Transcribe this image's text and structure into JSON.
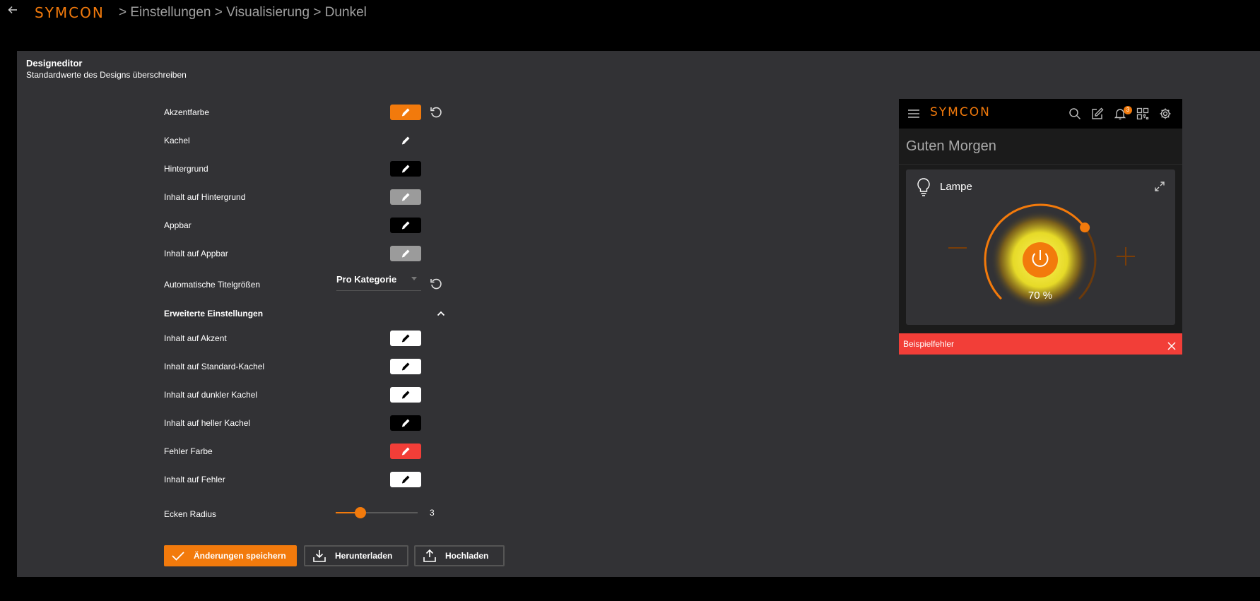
{
  "topbar": {
    "logo": "SYMCON",
    "breadcrumb": "> Einstellungen > Visualisierung > Dunkel"
  },
  "editor": {
    "title": "Designeditor",
    "subtitle": "Standardwerte des Designs überschreiben",
    "rows": [
      {
        "label": "Akzentfarbe",
        "color": "#f27a0c",
        "pen": "#ffffff"
      },
      {
        "label": "Kachel",
        "color": "#323235",
        "pen": "#ffffff"
      },
      {
        "label": "Hintergrund",
        "color": "#000000",
        "pen": "#ffffff"
      },
      {
        "label": "Inhalt auf Hintergrund",
        "color": "#9b9b9b",
        "pen": "#ffffff"
      },
      {
        "label": "Appbar",
        "color": "#000000",
        "pen": "#ffffff"
      },
      {
        "label": "Inhalt auf Appbar",
        "color": "#9b9b9b",
        "pen": "#ffffff"
      }
    ],
    "title_size": {
      "label": "Automatische Titelgrößen",
      "value": "Pro Kategorie"
    },
    "advanced": {
      "label": "Erweiterte Einstellungen",
      "rows": [
        {
          "label": "Inhalt auf Akzent",
          "color": "#ffffff",
          "pen": "#000000"
        },
        {
          "label": "Inhalt auf Standard-Kachel",
          "color": "#ffffff",
          "pen": "#000000"
        },
        {
          "label": "Inhalt auf dunkler Kachel",
          "color": "#ffffff",
          "pen": "#000000"
        },
        {
          "label": "Inhalt auf heller Kachel",
          "color": "#000000",
          "pen": "#ffffff"
        },
        {
          "label": "Fehler Farbe",
          "color": "#f23e38",
          "pen": "#ffffff"
        },
        {
          "label": "Inhalt auf Fehler",
          "color": "#ffffff",
          "pen": "#000000"
        }
      ]
    },
    "corner_radius": {
      "label": "Ecken Radius",
      "value": "3",
      "fraction": 0.3
    },
    "buttons": {
      "save": "Änderungen speichern",
      "download": "Herunterladen",
      "upload": "Hochladen"
    }
  },
  "preview": {
    "logo": "SYMCON",
    "notification_count": "3",
    "greeting": "Guten Morgen",
    "tile_title": "Lampe",
    "percent": "70 %",
    "level": 0.7,
    "error_text": "Beispielfehler",
    "accent": "#f27a0c",
    "error_color": "#f23e38"
  }
}
